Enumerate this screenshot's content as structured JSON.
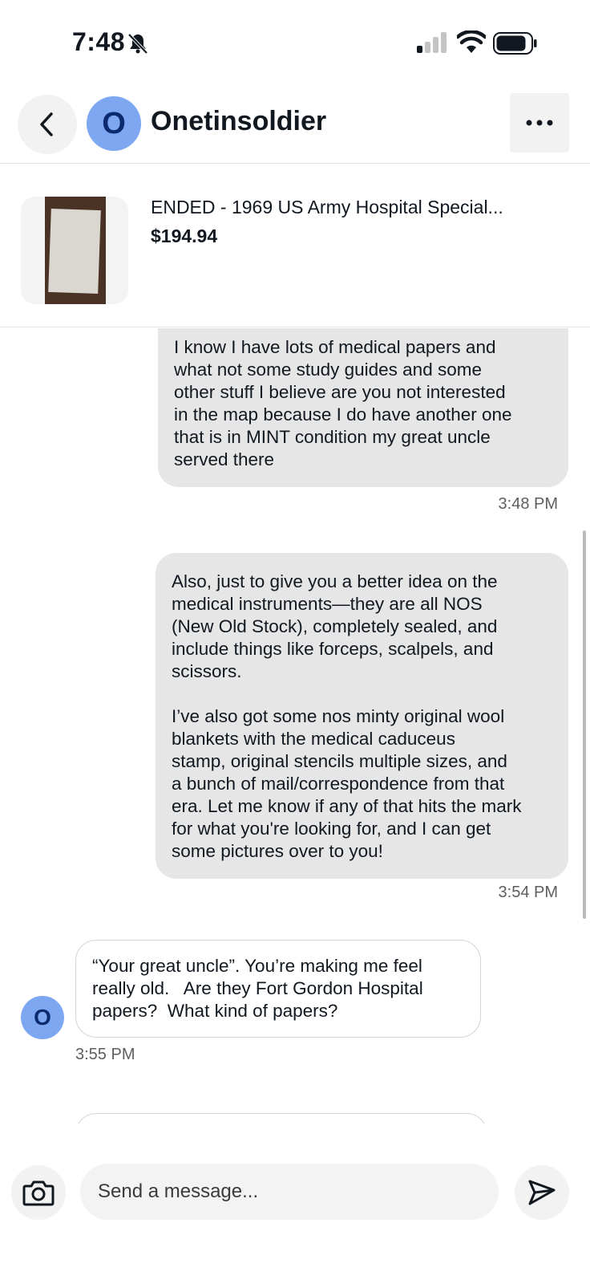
{
  "status_bar": {
    "time": "7:48",
    "icons": [
      "bell-slash-icon",
      "cellular-signal-icon",
      "wifi-icon",
      "battery-icon"
    ]
  },
  "header": {
    "back_icon": "chevron-left-icon",
    "avatar_letter": "O",
    "title": "Onetinsoldier",
    "more_icon": "ellipsis-icon"
  },
  "listing": {
    "title": "ENDED - 1969 US Army Hospital Special...",
    "price": "$194.94"
  },
  "messages": [
    {
      "direction": "outgoing",
      "text": "I know I have lots of medical papers and\nwhat not some study guides and some\nother stuff I believe are you not interested\nin the map because I do have another one\nthat is in MINT condition my great uncle\nserved there",
      "time": "3:48 PM"
    },
    {
      "direction": "outgoing",
      "text": "Also, just to give you a better idea on the\nmedical instruments—they are all NOS\n(New Old Stock), completely sealed, and\ninclude things like forceps, scalpels, and\nscissors.\n\nI’ve also got some nos minty original wool\nblankets with the medical caduceus\nstamp, original stencils multiple sizes, and\na bunch of mail/correspondence from that\nera. Let me know if any of that hits the mark\nfor what you're looking for, and I can get\nsome pictures over to you!",
      "time": "3:54 PM"
    },
    {
      "direction": "incoming",
      "avatar_letter": "O",
      "text": "“Your great uncle”. You’re making me feel\nreally old.   Are they Fort Gordon Hospital\npapers?  What kind of papers?",
      "time": "3:55 PM"
    }
  ],
  "composer": {
    "camera_icon": "camera-icon",
    "placeholder": "Send a message...",
    "send_icon": "send-icon"
  },
  "colors": {
    "avatar_bg": "#7ea7f2",
    "avatar_text": "#0c2b6e",
    "outgoing_bubble": "#e6e6e6",
    "incoming_border": "#d5d5d5"
  }
}
